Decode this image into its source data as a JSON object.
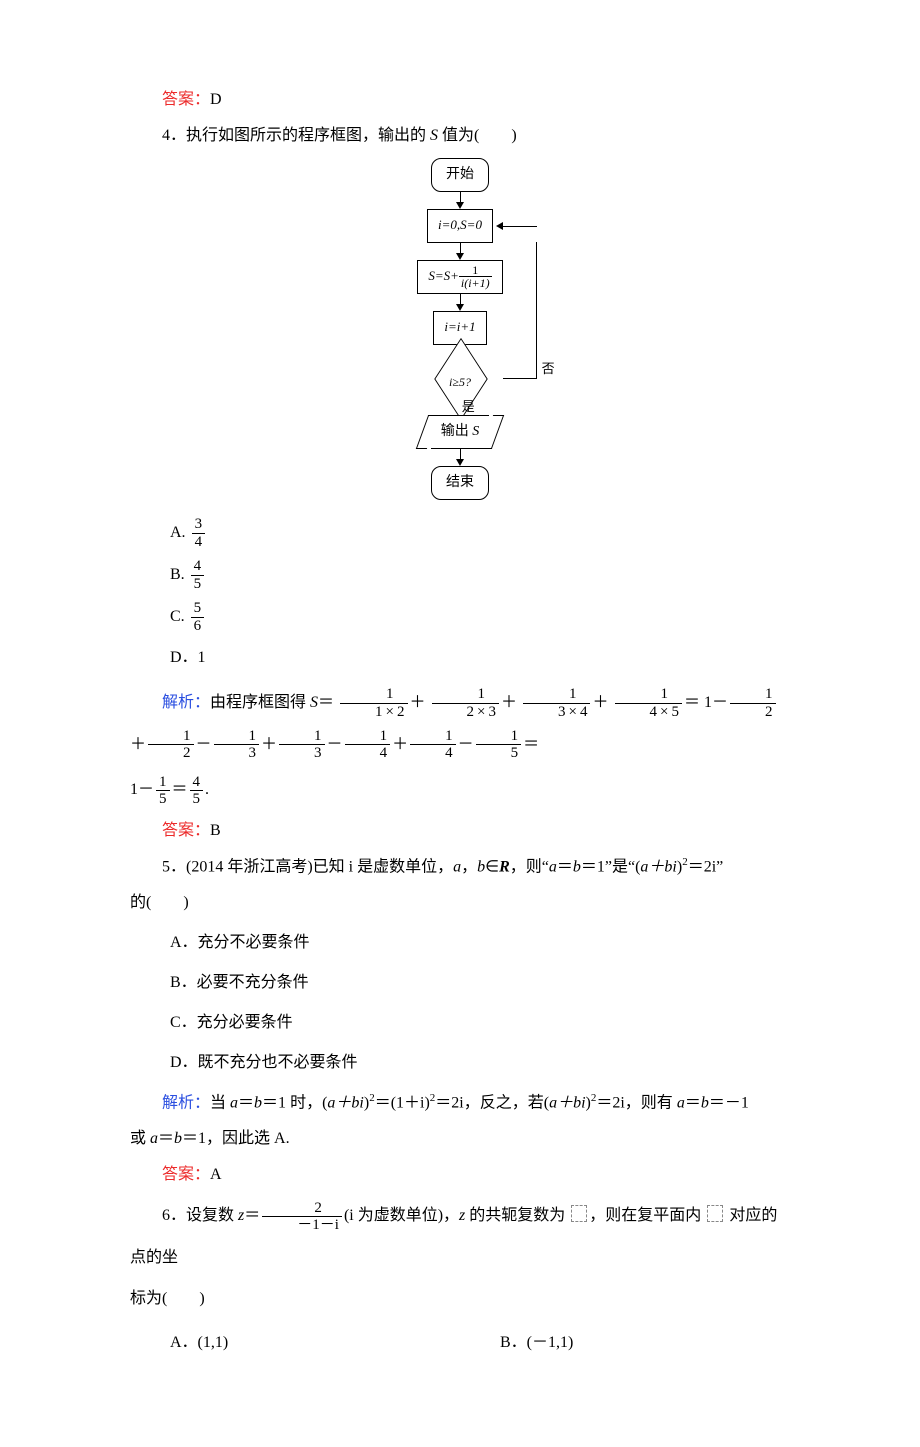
{
  "answer_label": "答案：",
  "parse_label": "解析：",
  "q3": {
    "answer_value": "D"
  },
  "q4": {
    "stem_prefix": "4．执行如图所示的程序框图，输出的 ",
    "stem_var": "S",
    "stem_suffix": " 值为(　　)",
    "optA_num": "3",
    "optA_den": "4",
    "optB_num": "4",
    "optB_den": "5",
    "optC_num": "5",
    "optC_den": "6",
    "optD": "D．1",
    "parse_pre": "由程序框图得 ",
    "parse_eq": "＝",
    "f1n": "1",
    "f1d": "1 × 2",
    "f2n": "1",
    "f2d": "2 × 3",
    "f3n": "1",
    "f3d": "3 × 4",
    "f4n": "1",
    "f4d": "4 × 5",
    "s1": "1",
    "s2_n": "1",
    "s2_d": "2",
    "s3_n": "1",
    "s3_d": "2",
    "s4_n": "1",
    "s4_d": "3",
    "s5_n": "1",
    "s5_d": "3",
    "s6_n": "1",
    "s6_d": "4",
    "s7_n": "1",
    "s7_d": "4",
    "s8_n": "1",
    "s8_d": "5",
    "tail_pre": "1－",
    "tail_fa_n": "1",
    "tail_fa_d": "5",
    "tail_eq": "＝",
    "tail_fb_n": "4",
    "tail_fb_d": "5",
    "tail_dot": ".",
    "answer_value": "B",
    "flow": {
      "start": "开始",
      "init": "i=0,S=0",
      "step_pre": "S=S+",
      "step_num": "1",
      "step_den": "i(i+1)",
      "inc": "i=i+1",
      "cond": "i≥5?",
      "no": "否",
      "yes": "是",
      "out_pre": "输出 ",
      "out_var": "S",
      "end": "结束"
    }
  },
  "q5": {
    "stem": "5．(2014 年浙江高考)已知 i 是虚数单位，",
    "stem_mid": "，则“",
    "stem_cond1_a": "a",
    "stem_cond1_eq1": "＝",
    "stem_cond1_b": "b",
    "stem_cond1_eq2": "＝1",
    "stem_cond1_close": "”是“(",
    "stem_abi": "a＋bi",
    "stem_sq": ")",
    "stem_exp": "2",
    "stem_eq2i": "＝2i”",
    "stem_tail": "的(　　)",
    "ab_in_R_a": "a",
    "ab_in_R_comma": "，",
    "ab_in_R_b": "b",
    "ab_in_R_in": "∈",
    "ab_in_R_R": "R",
    "optA": "A．充分不必要条件",
    "optB": "B．必要不充分条件",
    "optC": "C．充分必要条件",
    "optD": "D．既不充分也不必要条件",
    "parse_1": "当 ",
    "parse_eqab1_a": "a",
    "parse_eqab1": "＝",
    "parse_eqab1_b": "b",
    "parse_eqab1_v": "＝1",
    "parse_2": " 时，(",
    "parse_abi": "a＋bi",
    "parse_r1": ")",
    "parse_exp": "2",
    "parse_eq": "＝(1＋i)",
    "parse_exp2": "2",
    "parse_eq2": "＝2i，反之，若(",
    "parse_abi2": "a＋bi",
    "parse_r2": ")",
    "parse_exp3": "2",
    "parse_eq3": "＝2i，则有 ",
    "parse_abm1_a": "a",
    "parse_abm1": "＝",
    "parse_abm1_b": "b",
    "parse_abm1_v": "＝－1",
    "parse_line2_pre": "或 ",
    "parse_line2_a": "a",
    "parse_line2_eq": "＝",
    "parse_line2_b": "b",
    "parse_line2_v": "＝1，因此选 A.",
    "answer_value": "A"
  },
  "q6": {
    "stem_pre": "6．设复数 ",
    "z": "z",
    "eq": "＝",
    "frac_num": "2",
    "frac_den": "－1－i",
    "stem_mid": "(i 为虚数单位)，",
    "z2": "z",
    "stem_conj": " 的共轭复数为 ",
    "stem_box_after1": "，则在复平面内 ",
    "stem_box_after2": " 对应的点的坐",
    "stem_line2": "标为(　　)",
    "optA": "A．(1,1)",
    "optB": "B．(－1,1)"
  }
}
